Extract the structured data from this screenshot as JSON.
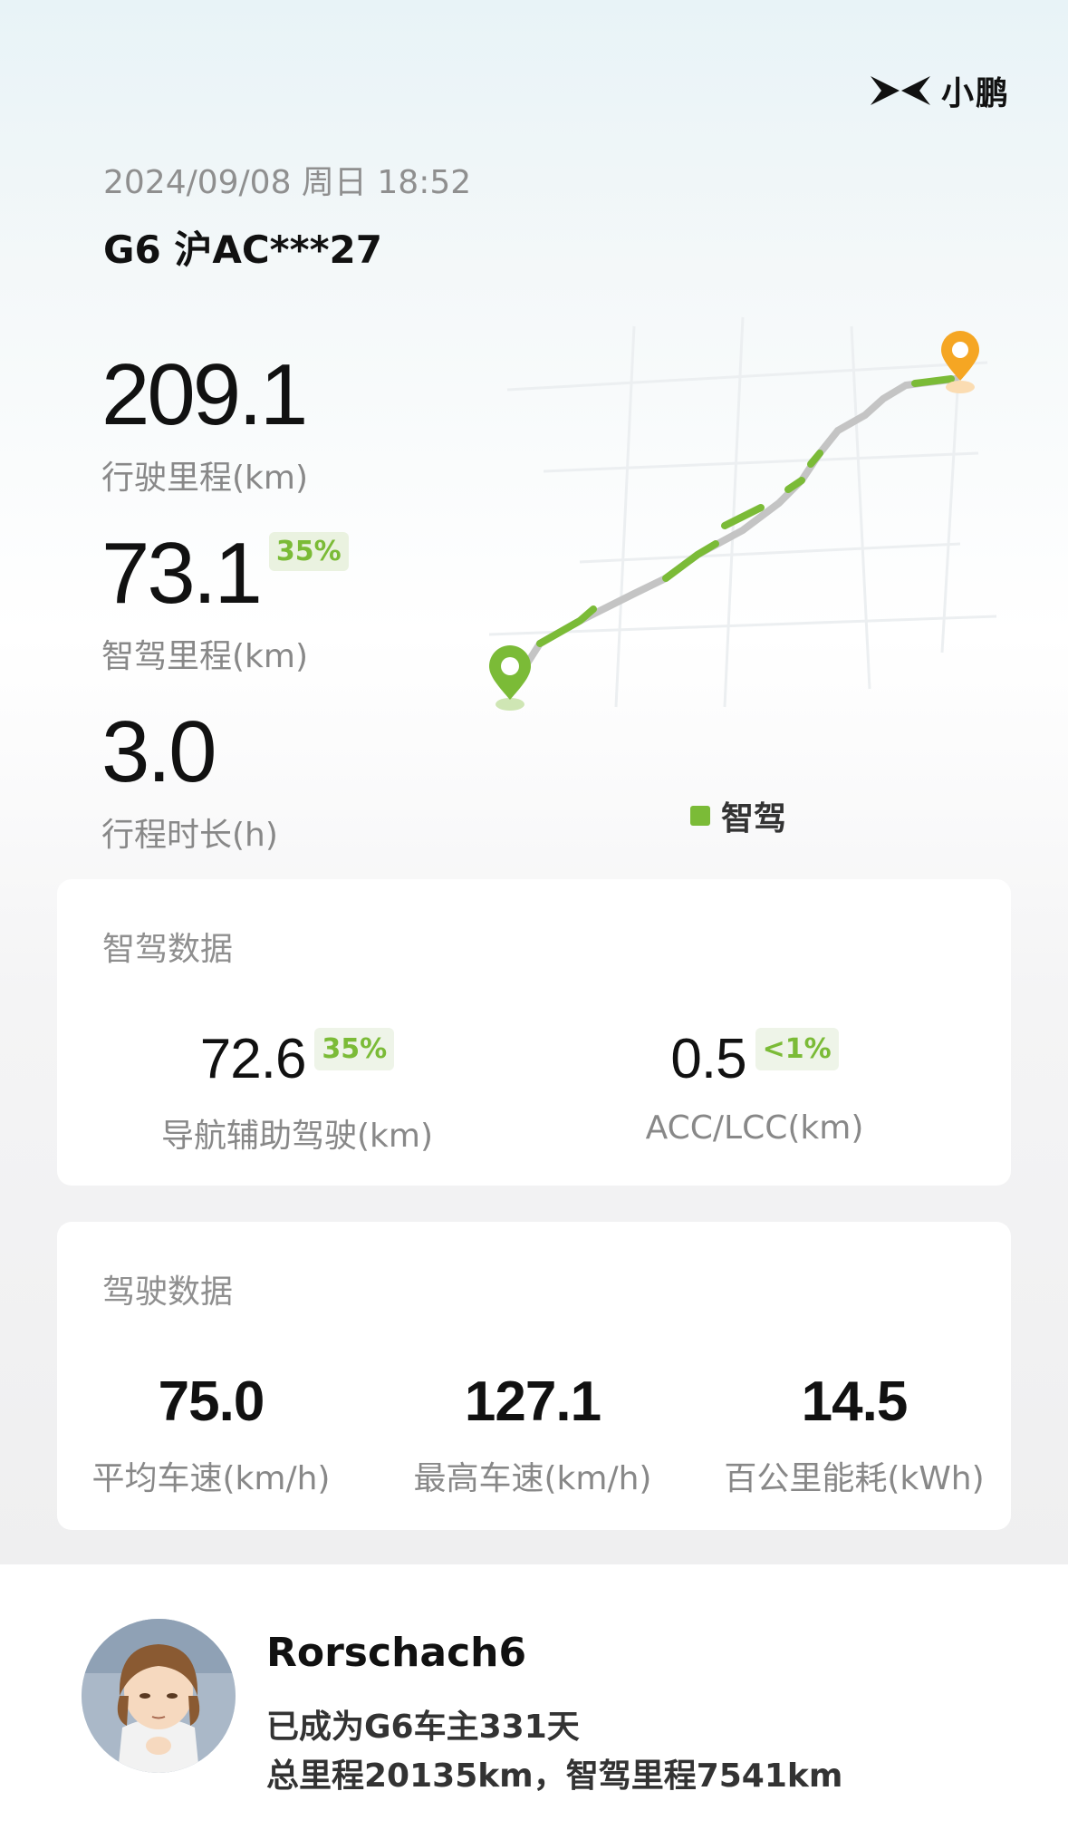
{
  "brand": {
    "name": "小鹏"
  },
  "trip": {
    "datetime": "2024/09/08 周日 18:52",
    "vehicle": "G6 沪AC***27",
    "distance": {
      "value": "209.1",
      "label": "行驶里程(km)"
    },
    "smart_distance": {
      "value": "73.1",
      "percent": "35%",
      "label": "智驾里程(km)"
    },
    "duration": {
      "value": "3.0",
      "label": "行程时长(h)"
    }
  },
  "map": {
    "legend_label": "智驾",
    "colors": {
      "smart": "#7bbb37",
      "manual": "#c4c4c4",
      "start_pin": "#7bbb37",
      "end_pin": "#f5a623"
    }
  },
  "smart_card": {
    "title": "智驾数据",
    "nav": {
      "value": "72.6",
      "percent": "35%",
      "label": "导航辅助驾驶(km)"
    },
    "acc": {
      "value": "0.5",
      "percent": "<1%",
      "label": "ACC/LCC(km)"
    }
  },
  "drive_card": {
    "title": "驾驶数据",
    "avg_speed": {
      "value": "75.0",
      "label": "平均车速(km/h)"
    },
    "max_speed": {
      "value": "127.1",
      "label": "最高车速(km/h)"
    },
    "consumption": {
      "value": "14.5",
      "label": "百公里能耗(kWh)"
    }
  },
  "user": {
    "name": "Rorschach6",
    "owner_days": "已成为G6车主331天",
    "totals": "总里程20135km，智驾里程7541km"
  },
  "colors": {
    "accent": "#7bbb37",
    "accent_bg": "#eaf2e0"
  }
}
